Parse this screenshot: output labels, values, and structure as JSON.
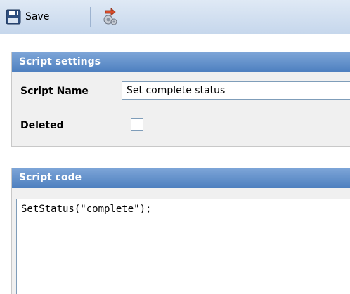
{
  "toolbar": {
    "save_label": "Save",
    "save_icon": "floppy-disk-icon",
    "restore_icon": "restore-arrow-icon"
  },
  "script_settings": {
    "header": "Script settings",
    "name_label": "Script Name",
    "name_value": "Set complete status",
    "deleted_label": "Deleted",
    "deleted_checked": false
  },
  "script_code": {
    "header": "Script code",
    "code": "SetStatus(\"complete\");"
  },
  "colors": {
    "header_blue": "#4d7fbf",
    "toolbar_bg": "#c6d7ec",
    "panel_bg": "#f0f0f0"
  }
}
